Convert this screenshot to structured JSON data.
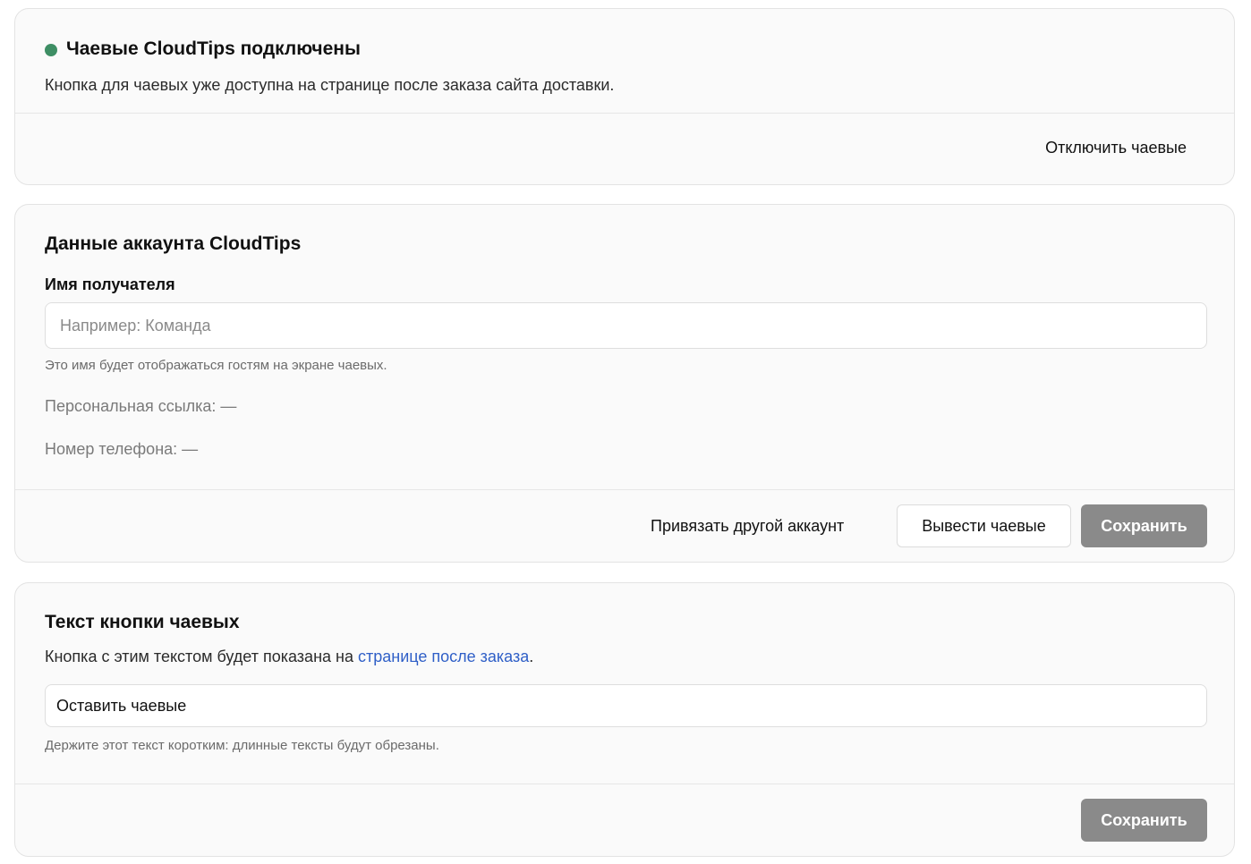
{
  "status_card": {
    "title": "Чаевые CloudTips подключены",
    "description": "Кнопка для чаевых уже доступна на странице после заказа сайта доставки.",
    "disable_label": "Отключить чаевые",
    "status_color": "#3e8e64"
  },
  "account_card": {
    "title": "Данные аккаунта CloudTips",
    "recipient_label": "Имя получателя",
    "recipient_value": "",
    "recipient_placeholder": "Например: Команда",
    "recipient_hint": "Это имя будет отображаться гостям на экране чаевых.",
    "personal_link": "Персональная ссылка: —",
    "phone": "Номер телефона: —",
    "link_account_label": "Привязать другой аккаунт",
    "withdraw_label": "Вывести чаевые",
    "save_label": "Сохранить"
  },
  "button_text_card": {
    "title": "Текст кнопки чаевых",
    "description_prefix": "Кнопка с этим текстом будет показана на ",
    "description_link": "странице после заказа",
    "description_suffix": ".",
    "button_text_value": "Оставить чаевые",
    "hint": "Держите этот текст коротким: длинные тексты будут обрезаны.",
    "save_label": "Сохранить"
  },
  "colors": {
    "primary_disabled": "#8a8a8a",
    "link": "#2f5fc7"
  }
}
